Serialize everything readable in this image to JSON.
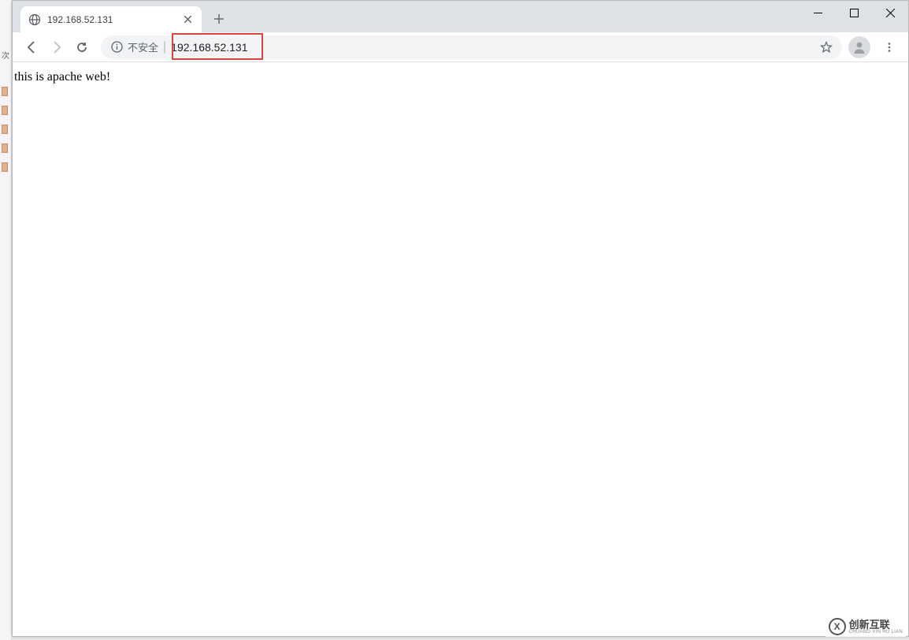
{
  "left_strip": {
    "label": "次"
  },
  "tab": {
    "title": "192.168.52.131"
  },
  "window_controls": {
    "minimize": "—",
    "maximize": "☐",
    "close": "✕"
  },
  "toolbar": {
    "security_label": "不安全",
    "separator": "|",
    "url": "192.168.52.131"
  },
  "content": {
    "body_text": "this is apache web!"
  },
  "watermark": {
    "logo_letter": "X",
    "main": "创新互联",
    "sub": "CHUANG XIN HU LIAN"
  },
  "colors": {
    "highlight_border": "#d9453a",
    "tab_bar": "#dee1e6",
    "address_bg": "#f1f3f4"
  }
}
